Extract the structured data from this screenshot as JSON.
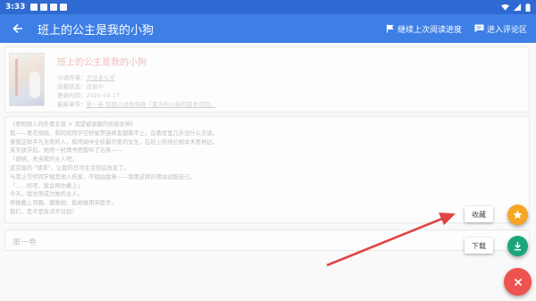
{
  "status_bar": {
    "time": "3:33"
  },
  "app_bar": {
    "title": "班上的公主是我的小狗",
    "continue_reading": "继续上次阅读进度",
    "comments": "进入评论区"
  },
  "book": {
    "title": "班上的公主是我的小狗",
    "author_label": "小说作者：",
    "author": "犬甘あんず",
    "status_label": "连载状态：",
    "status": "连载中",
    "updated_label": "更新时间：",
    "updated": "2025-09-17",
    "latest_label": "最新章节：",
    "latest": "第一卷 短篇小说季特典「夏天的小狗的夏季活用」"
  },
  "description": [
    "《要照顾人的外素女孩 × 渴望被驯教的班级女神》",
    "我——葛花胡桃，和同班同学空桥星梦连续发都算不上，在教室里几乎没什么交谈。",
    "查我这样平凡无奇的人，和传闻中全校最可爱的女生，在班上的地位根本天差地远。",
    "某天放学后，她用一封情书把我叫了出来——",
    "「胡桃，来当我的主人吧」",
    "这究竟的 \"请求\"，让我的日常生活彻底改变了。",
    "与其让空桥同学被其他人伤害，不如由我来——我用这样的理由说服自己。",
    "「……好吧，我会帮你戴上」",
    "今天，我也用成为她的主人。",
    "帮她戴上项圈、摸教她、能她做用带股步。",
    "我们，是不是有点不对劲？"
  ],
  "volume": {
    "label": "第一卷"
  },
  "fabs": {
    "favorite_label": "收藏",
    "download_label": "下载"
  },
  "colors": {
    "status_bar": "#2e6ad1",
    "app_bar": "#3e7fe6",
    "favorite": "#f5a623",
    "download": "#1aa67a",
    "close": "#ef5350",
    "annotation_arrow": "#e04545"
  },
  "icons": {
    "back": "arrow-left-icon",
    "continue": "flag-icon",
    "comments": "chat-icon",
    "favorite": "star-icon",
    "download": "download-icon",
    "close": "close-icon"
  }
}
